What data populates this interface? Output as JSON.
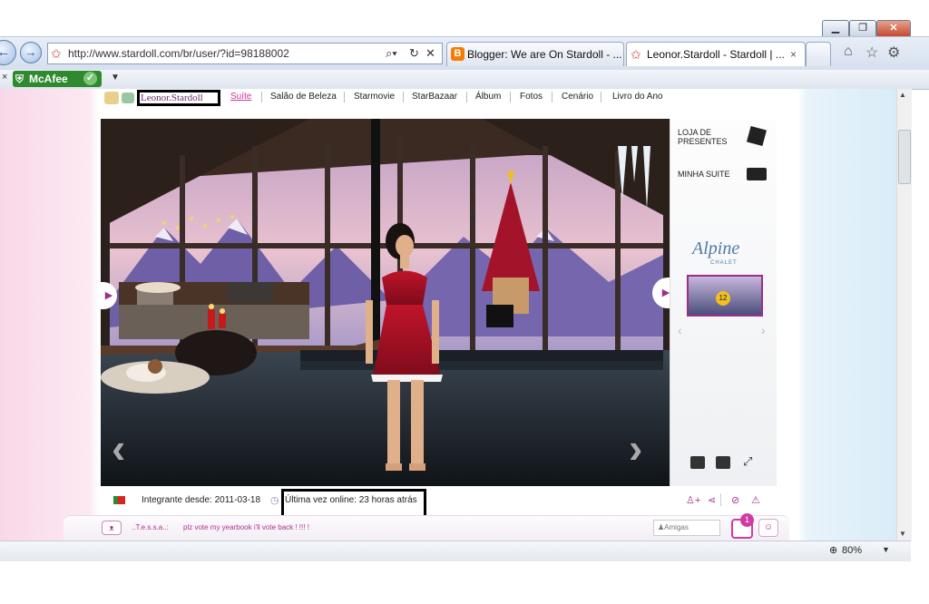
{
  "browser": {
    "address": "http://www.stardoll.com/br/user/?id=98188002",
    "tabs": [
      {
        "label": "Blogger: We are On Stardoll - ..."
      },
      {
        "label": "Leonor.Stardoll - Stardoll | ..."
      }
    ],
    "toolbar": {
      "mcafee": "McAfee"
    },
    "zoom": "80%"
  },
  "profile": {
    "username": "Leonor.Stardoll",
    "menu": [
      "Suíte",
      "Salão de Beleza",
      "Starmovie",
      "StarBazaar",
      "Álbum",
      "Fotos",
      "Cenário",
      "Livro do Ano"
    ],
    "active_menu": "Suíte",
    "member_since": "Integrante desde: 2011-03-18",
    "last_online": "Última vez online: 23 horas atrás"
  },
  "panel": {
    "gift_shop": "LOJA DE PRESENTES",
    "my_suite": "MINHA SUITE",
    "theme_name": "Alpine",
    "theme_sub": "CHALET",
    "badge": "12"
  },
  "chat": {
    "user": "..T.e.s.s.a..:",
    "message": "plz vote my yearbook i'll vote back ! !!! !",
    "friends_placeholder": "Amigas",
    "notification_count": "1"
  },
  "colors": {
    "accent": "#cc3399",
    "browser_blue": "#d6e0ee"
  }
}
